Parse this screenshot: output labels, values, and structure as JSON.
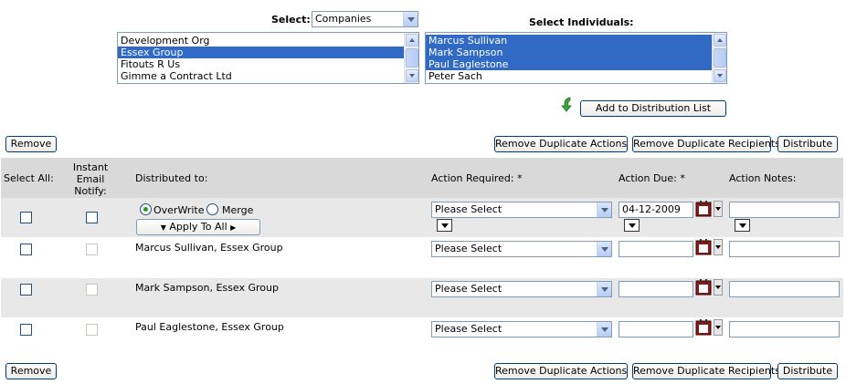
{
  "selector": {
    "select_label": "Select:",
    "select_value": "Companies",
    "individuals_label": "Select Individuals:",
    "companies": [
      {
        "label": "Development Org",
        "selected": false
      },
      {
        "label": "Essex Group",
        "selected": true
      },
      {
        "label": "Fitouts R Us",
        "selected": false
      },
      {
        "label": "Gimme a Contract Ltd",
        "selected": false
      }
    ],
    "individuals": [
      {
        "label": "Marcus Sullivan",
        "selected": true
      },
      {
        "label": "Mark Sampson",
        "selected": true
      },
      {
        "label": "Paul Eaglestone",
        "selected": true
      },
      {
        "label": "Peter Sach",
        "selected": false
      }
    ],
    "add_button": "Add to Distribution List"
  },
  "toolbar": {
    "remove": "Remove",
    "remove_duplicate_actions": "Remove Duplicate Actions",
    "remove_duplicate_recipients": "Remove Duplicate Recipients",
    "distribute": "Distribute"
  },
  "table": {
    "headers": {
      "select_all": "Select All:",
      "instant_email": "Instant Email Notify:",
      "distributed_to": "Distributed to:",
      "action_required": "Action Required: *",
      "action_due": "Action Due: *",
      "action_notes": "Action Notes:"
    },
    "apply_row": {
      "overwrite": "OverWrite",
      "merge": "Merge",
      "apply_to_all": "Apply To All",
      "action_required": "Please Select",
      "action_due": "04-12-2009",
      "action_notes": ""
    },
    "rows": [
      {
        "name": "Marcus Sullivan, Essex Group",
        "action_required": "Please Select",
        "action_due": "",
        "action_notes": ""
      },
      {
        "name": "Mark Sampson, Essex Group",
        "action_required": "Please Select",
        "action_due": "",
        "action_notes": ""
      },
      {
        "name": "Paul Eaglestone, Essex Group",
        "action_required": "Please Select",
        "action_due": "",
        "action_notes": ""
      }
    ]
  },
  "colors": {
    "selection": "#316ac5",
    "header_bg": "#d9d9d9",
    "row_alt": "#e8e8e8",
    "radio_dot": "#21a121"
  }
}
